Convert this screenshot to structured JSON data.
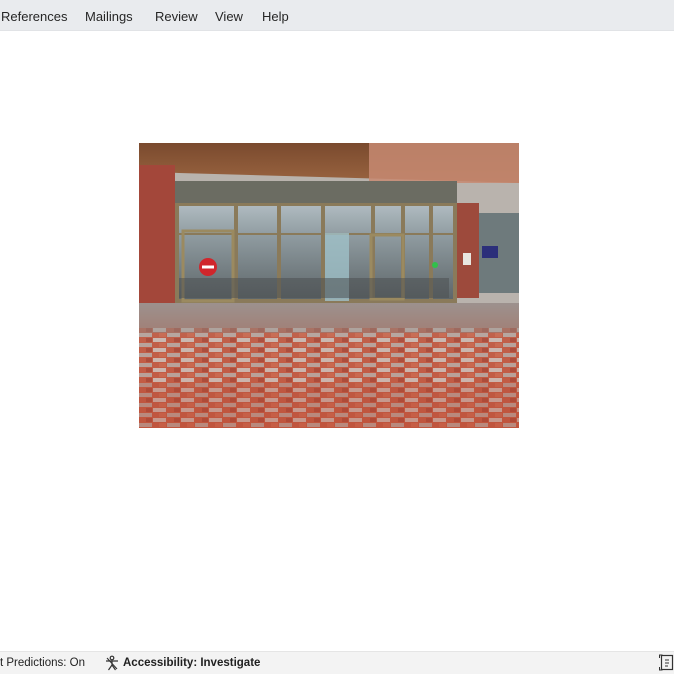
{
  "ribbon": {
    "tabs": [
      {
        "label": "References"
      },
      {
        "label": "Mailings"
      },
      {
        "label": "Review"
      },
      {
        "label": "View"
      },
      {
        "label": "Help"
      }
    ]
  },
  "document": {
    "image": {
      "subject": "storefront-photo",
      "door_sign_color": "#d0262c",
      "paving_colors": [
        "#c8563e",
        "#bdbbb6",
        "#a64432"
      ],
      "brick_color": "#a3473a"
    }
  },
  "status_bar": {
    "text_predictions": "t Predictions: On",
    "accessibility": "Accessibility: Investigate",
    "accessibility_icon": "accessibility-icon",
    "view_icon": "focus-view-icon"
  }
}
